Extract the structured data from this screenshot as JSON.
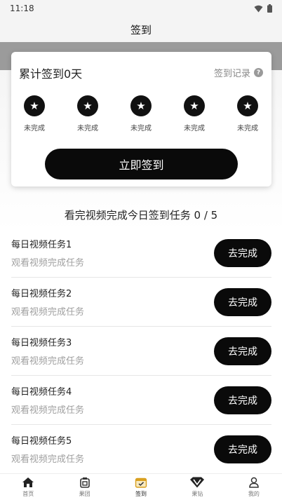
{
  "status_bar": {
    "time": "11:18"
  },
  "header": {
    "title": "签到"
  },
  "checkin_card": {
    "title": "累计签到0天",
    "record_link": "签到记录",
    "days": [
      {
        "status": "未完成"
      },
      {
        "status": "未完成"
      },
      {
        "status": "未完成"
      },
      {
        "status": "未完成"
      },
      {
        "status": "未完成"
      }
    ],
    "button_label": "立即签到"
  },
  "tasks": {
    "heading": "看完视频完成今日签到任务 0 / 5",
    "items": [
      {
        "name": "每日视频任务1",
        "desc": "观看视频完成任务",
        "button": "去完成"
      },
      {
        "name": "每日视频任务2",
        "desc": "观看视频完成任务",
        "button": "去完成"
      },
      {
        "name": "每日视频任务3",
        "desc": "观看视频完成任务",
        "button": "去完成"
      },
      {
        "name": "每日视频任务4",
        "desc": "观看视频完成任务",
        "button": "去完成"
      },
      {
        "name": "每日视频任务5",
        "desc": "观看视频完成任务",
        "button": "去完成"
      }
    ]
  },
  "tabbar": {
    "items": [
      {
        "label": "首页",
        "icon": "home-icon"
      },
      {
        "label": "果团",
        "icon": "group-icon"
      },
      {
        "label": "签到",
        "icon": "calendar-check-icon",
        "active": true
      },
      {
        "label": "果钻",
        "icon": "diamond-icon"
      },
      {
        "label": "我的",
        "icon": "user-icon"
      }
    ]
  }
}
